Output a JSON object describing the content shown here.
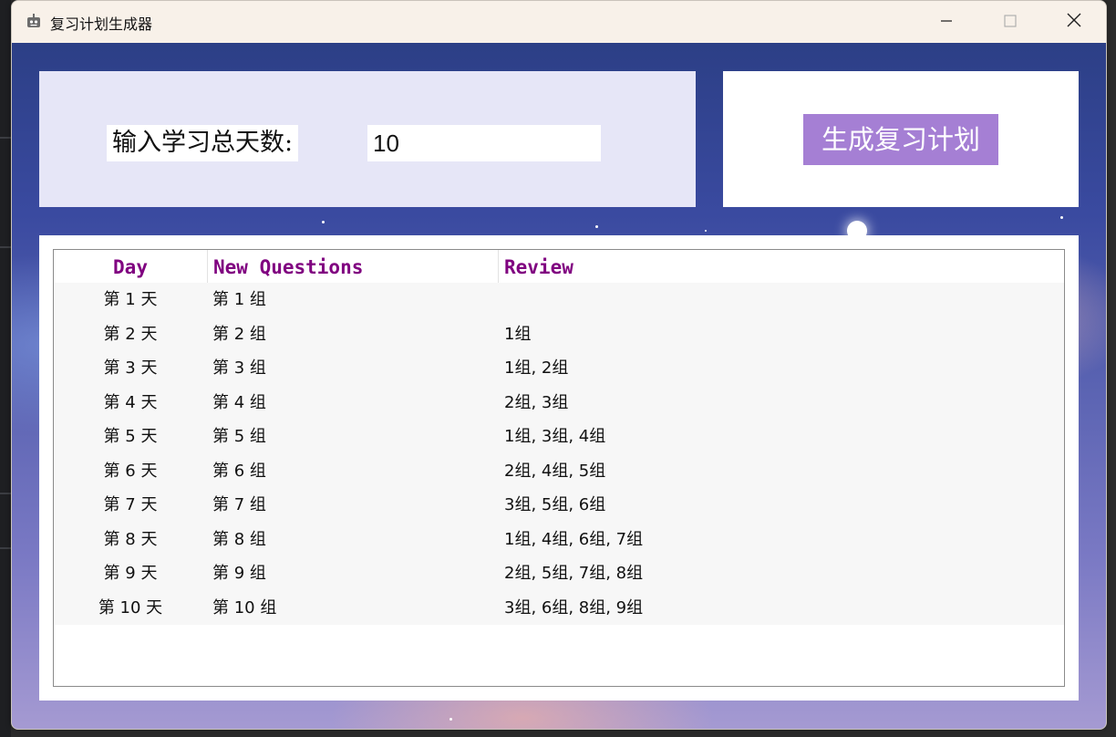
{
  "window": {
    "title": "复习计划生成器"
  },
  "form": {
    "label": "输入学习总天数:",
    "days_value": "10",
    "generate_button": "生成复习计划"
  },
  "table": {
    "headers": [
      "Day",
      "New Questions",
      "Review"
    ],
    "rows": [
      {
        "day": "第 1 天",
        "new": "第 1 组",
        "review": ""
      },
      {
        "day": "第 2 天",
        "new": "第 2 组",
        "review": "1组"
      },
      {
        "day": "第 3 天",
        "new": "第 3 组",
        "review": "1组, 2组"
      },
      {
        "day": "第 4 天",
        "new": "第 4 组",
        "review": "2组, 3组"
      },
      {
        "day": "第 5 天",
        "new": "第 5 组",
        "review": "1组, 3组, 4组"
      },
      {
        "day": "第 6 天",
        "new": "第 6 组",
        "review": "2组, 4组, 5组"
      },
      {
        "day": "第 7 天",
        "new": "第 7 组",
        "review": "3组, 5组, 6组"
      },
      {
        "day": "第 8 天",
        "new": "第 8 组",
        "review": "1组, 4组, 6组, 7组"
      },
      {
        "day": "第 9 天",
        "new": "第 9 组",
        "review": "2组, 5组, 7组, 8组"
      },
      {
        "day": "第 10 天",
        "new": "第 10 组",
        "review": "3组, 6组, 8组, 9组"
      }
    ]
  },
  "colors": {
    "header_text": "#800080",
    "button_bg": "#a57fd4",
    "input_panel_bg": "#e6e6f7"
  },
  "icons": {
    "app": "robot-app-icon",
    "minimize": "minimize-icon",
    "maximize": "maximize-icon",
    "close": "close-icon"
  }
}
